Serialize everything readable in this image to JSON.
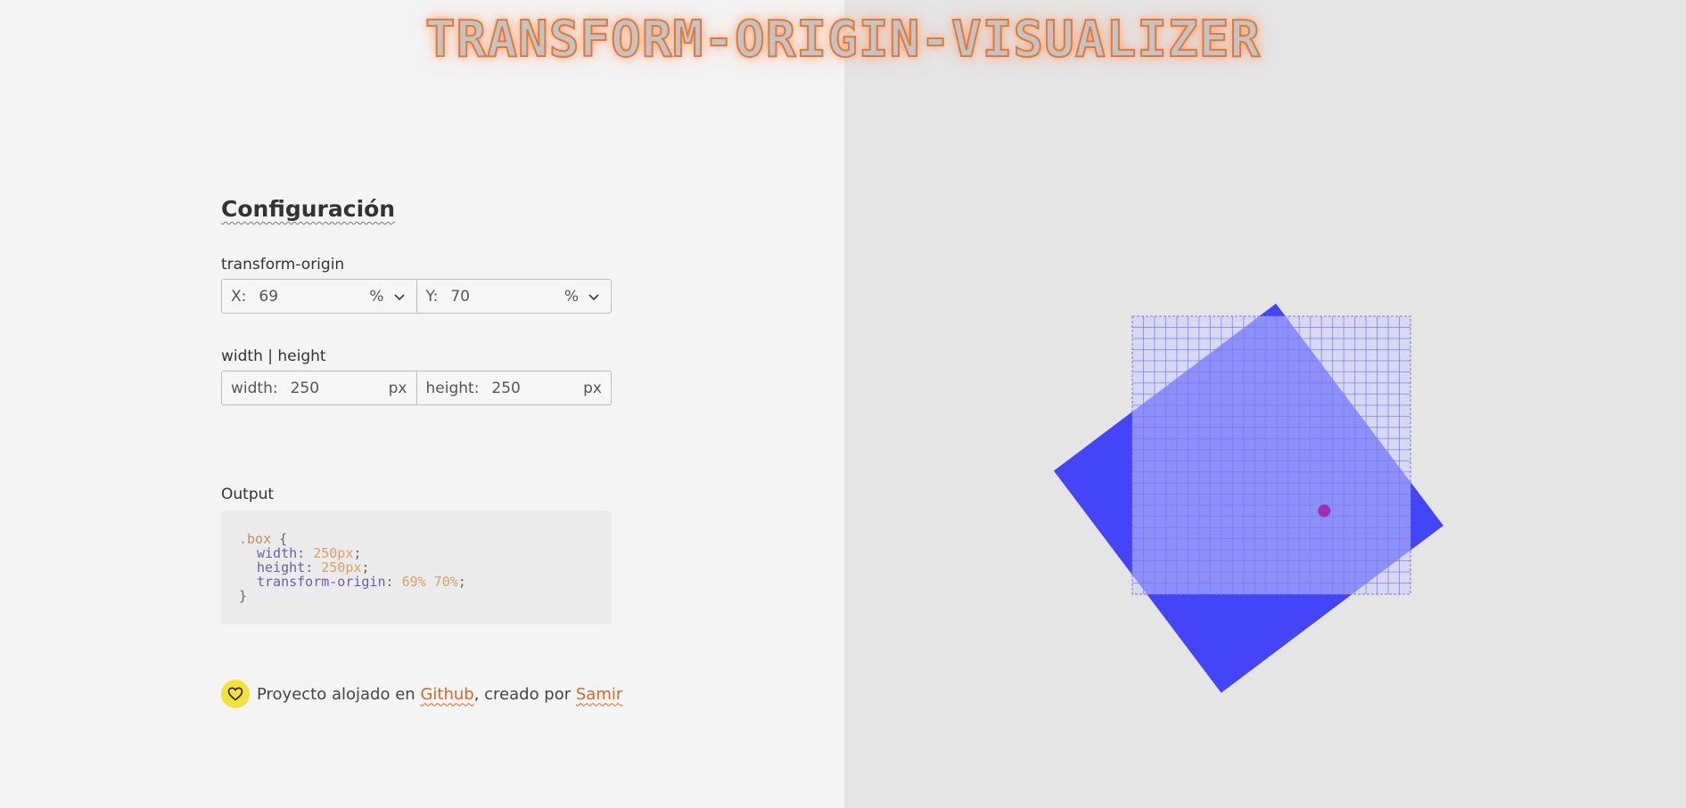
{
  "app": {
    "title": "TRANSFORM-ORIGIN-VISUALIZER"
  },
  "config": {
    "heading": "Configuración",
    "transform_origin": {
      "label": "transform-origin",
      "x": {
        "prefix": "X:",
        "value": "69",
        "unit": "%"
      },
      "y": {
        "prefix": "Y:",
        "value": "70",
        "unit": "%"
      }
    },
    "size": {
      "label": "width | height",
      "width": {
        "prefix": "width:",
        "value": "250",
        "unit": "px"
      },
      "height": {
        "prefix": "height:",
        "value": "250",
        "unit": "px"
      }
    },
    "output": {
      "label": "Output",
      "selector": ".box",
      "open_brace": "{",
      "close_brace": "}",
      "width_prop": "width",
      "width_val": "250px",
      "height_prop": "height",
      "height_val": "250px",
      "origin_prop": "transform-origin",
      "origin_val": "69% 70%"
    }
  },
  "footer": {
    "text1": "Proyecto alojado en",
    "link1": "Github",
    "text2": ", creado por",
    "link2": "Samir"
  },
  "preview": {
    "box_color": "#4444f8",
    "grid_color": "#6f7cf0",
    "origin_dot_color": "#a030b0"
  }
}
